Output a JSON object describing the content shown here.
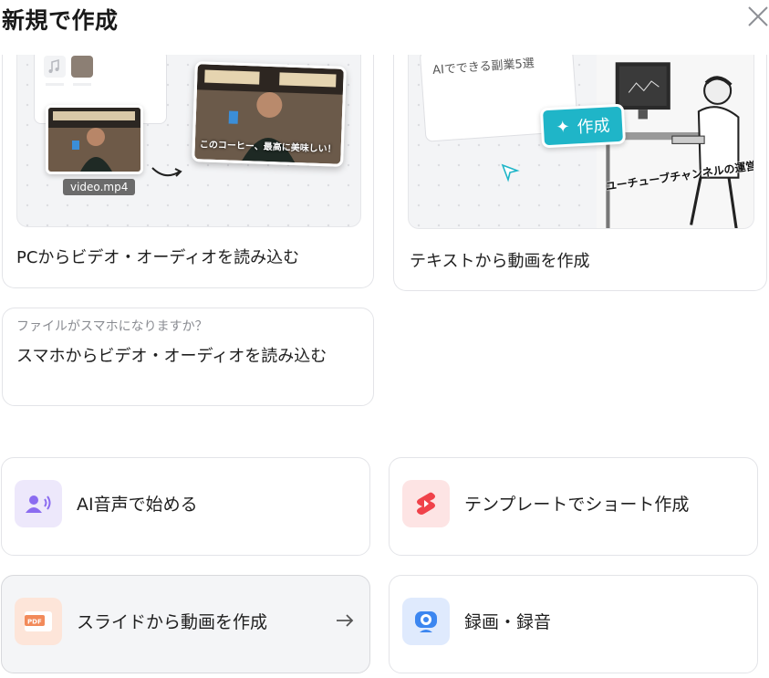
{
  "header": {
    "title": "新規で作成",
    "close_icon": "close-icon"
  },
  "cards": {
    "pc": {
      "label": "PCからビデオ・オーディオを読み込む",
      "preview": {
        "file_name": "video.mp4",
        "caption": "このコーヒー、最高に美味しい！"
      }
    },
    "text": {
      "label": "テキストから動画を作成",
      "preview": {
        "doc_text": "AIでできる副業5選",
        "button_label": "作成",
        "overlay_text": "ユーチューブチャンネルの運営"
      }
    },
    "phone": {
      "hint": "ファイルがスマホになりますか？",
      "label": "スマホからビデオ・オーディオを読み込む"
    }
  },
  "options": [
    {
      "label": "AI音声で始める",
      "icon": "ai-voice-icon",
      "icon_bg": "#ede8fb",
      "icon_color": "#8b6cf0"
    },
    {
      "label": "テンプレートでショート作成",
      "icon": "shorts-icon",
      "icon_bg": "#fde4e4",
      "icon_color": "#f0424a"
    },
    {
      "label": "スライドから動画を作成",
      "icon": "pdf-icon",
      "icon_bg": "#fde5d9",
      "icon_color": "#f28a5a"
    },
    {
      "label": "録画・録音",
      "icon": "webcam-icon",
      "icon_bg": "#dfeafd",
      "icon_color": "#3c86f0"
    }
  ],
  "accent": "#1fb5c8"
}
